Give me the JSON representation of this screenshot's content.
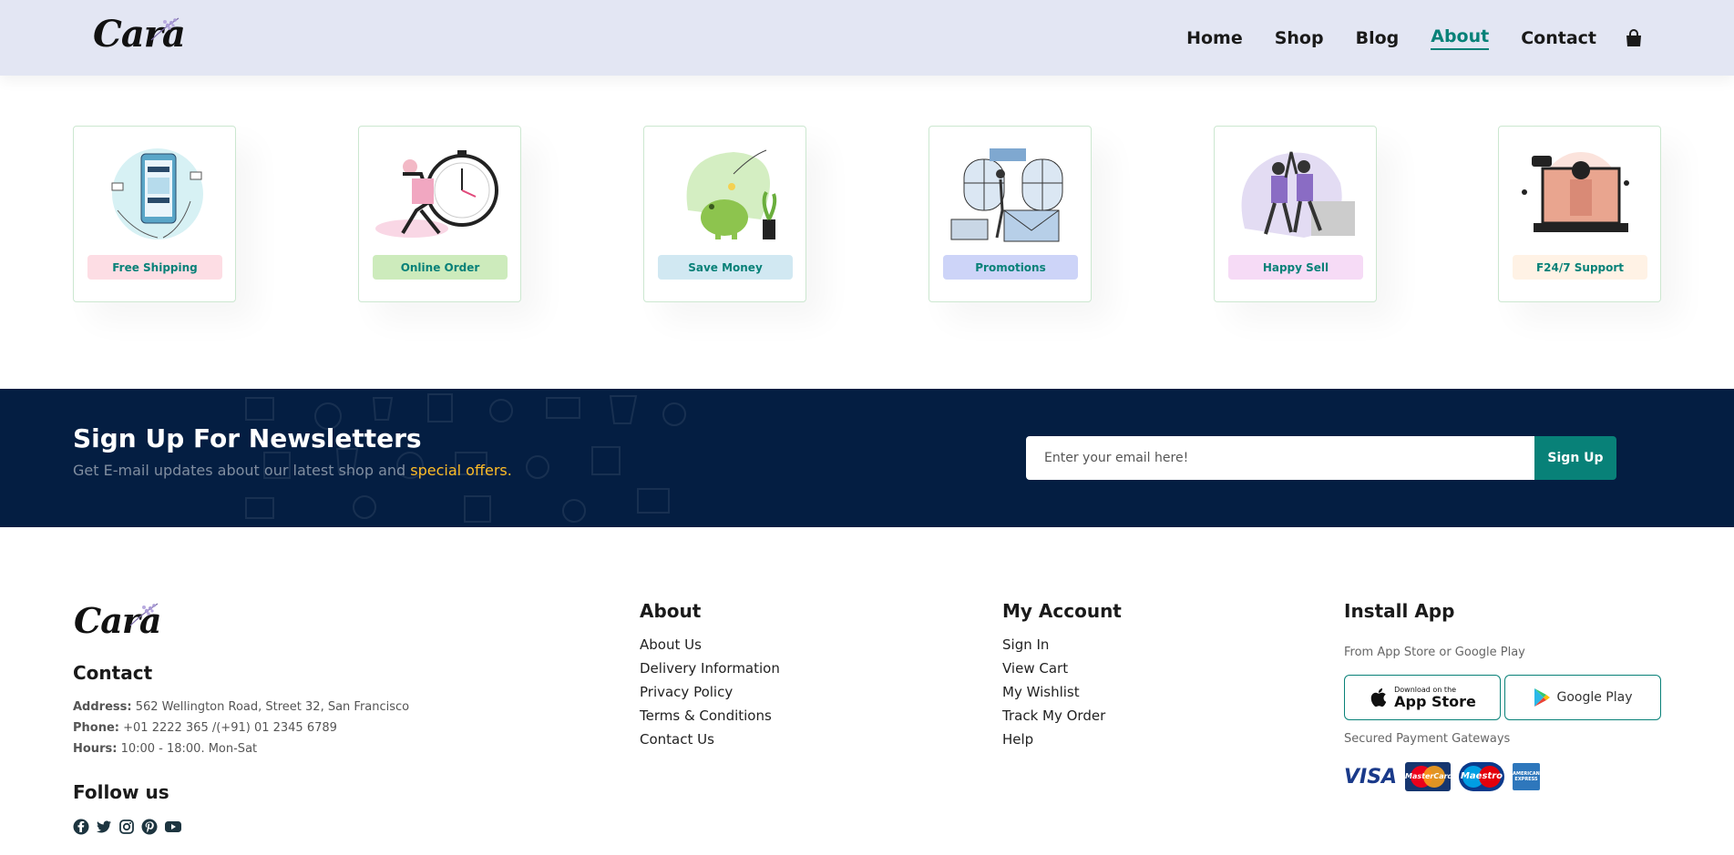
{
  "header": {
    "logo": "Cara",
    "nav": [
      "Home",
      "Shop",
      "Blog",
      "About",
      "Contact"
    ],
    "active": "About",
    "cart_icon": "shopping-bag-icon"
  },
  "features": [
    {
      "label": "Free Shipping",
      "bg": "#fddde4",
      "icon": "free-shipping-illustration"
    },
    {
      "label": "Online Order",
      "bg": "#cdebbc",
      "icon": "online-order-illustration"
    },
    {
      "label": "Save Money",
      "bg": "#d1e8f2",
      "icon": "save-money-illustration"
    },
    {
      "label": "Promotions",
      "bg": "#cdd4f8",
      "icon": "promotions-illustration"
    },
    {
      "label": "Happy Sell",
      "bg": "#f6dbf6",
      "icon": "happy-sell-illustration"
    },
    {
      "label": "F24/7 Support",
      "bg": "#fff2e5",
      "icon": "support-illustration"
    }
  ],
  "newsletter": {
    "title": "Sign Up For Newsletters",
    "subtitle": "Get E-mail updates about our latest shop and",
    "highlight": "special offers.",
    "placeholder": "Enter your email here!",
    "button": "Sign Up"
  },
  "footer": {
    "logo": "Cara",
    "contact_title": "Contact",
    "address_label": "Address:",
    "address": "562 Wellington Road, Street 32, San Francisco",
    "phone_label": "Phone:",
    "phone": "+01 2222 365 /(+91) 01 2345 6789",
    "hours_label": "Hours:",
    "hours": "10:00 - 18:00. Mon-Sat",
    "follow_title": "Follow us",
    "social": [
      "facebook-icon",
      "twitter-icon",
      "instagram-icon",
      "pinterest-icon",
      "youtube-icon"
    ],
    "about_title": "About",
    "about_links": [
      "About Us",
      "Delivery Information",
      "Privacy Policy",
      "Terms & Conditions",
      "Contact Us"
    ],
    "account_title": "My Account",
    "account_links": [
      "Sign In",
      "View Cart",
      "My Wishlist",
      "Track My Order",
      "Help"
    ],
    "app_title": "Install App",
    "app_sub": "From App Store or Google Play",
    "appstore_small": "Download on the",
    "appstore_big": "App Store",
    "googleplay": "Google Play",
    "payment_title": "Secured Payment Gateways",
    "payments": [
      "VISA",
      "MasterCard",
      "Maestro",
      "AMERICAN EXPRESS"
    ]
  },
  "colors": {
    "accent": "#088178",
    "header_bg": "#e3e6f3",
    "newsletter_bg": "#041e42",
    "highlight": "#ffbd27"
  }
}
